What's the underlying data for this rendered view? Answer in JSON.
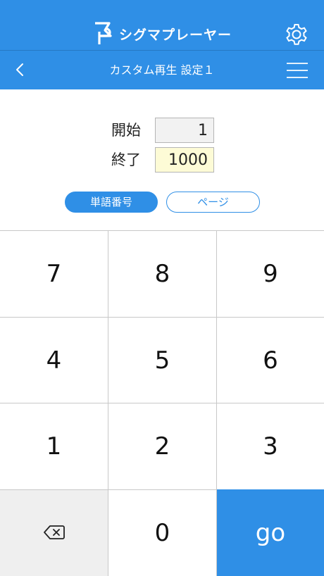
{
  "app": {
    "name": "シグマプレーヤー"
  },
  "icons": {
    "logo": "sigma-player-logo-icon",
    "settings": "gear-icon",
    "back": "chevron-left-icon",
    "menu": "hamburger-menu-icon",
    "delete": "backspace-icon"
  },
  "colors": {
    "brand": "#2f8fe6",
    "active_field": "#fdfbd6",
    "delete_key": "#efefef"
  },
  "nav": {
    "title": "カスタム再生 設定１"
  },
  "range": {
    "start_label": "開始",
    "start_value": "1",
    "end_label": "終了",
    "end_value": "1000",
    "active_field": "end"
  },
  "mode": {
    "selected": "単語番号",
    "unselected": "ページ"
  },
  "keypad": {
    "k7": "7",
    "k8": "8",
    "k9": "9",
    "k4": "4",
    "k5": "5",
    "k6": "6",
    "k1": "1",
    "k2": "2",
    "k3": "3",
    "k0": "0",
    "go": "go"
  }
}
